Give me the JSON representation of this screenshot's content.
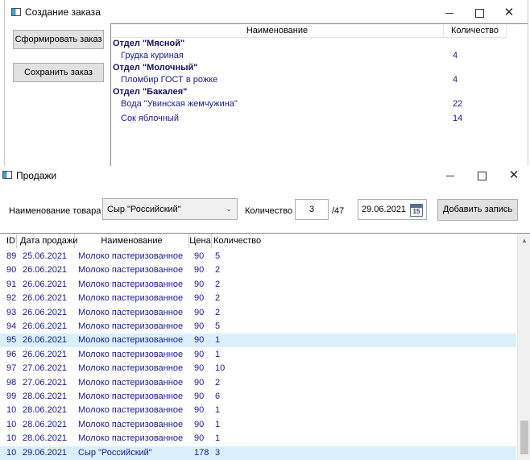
{
  "order_window": {
    "title": "Создание заказа",
    "form_order_label": "Сформировать заказ",
    "save_order_label": "Сохранить заказ",
    "columns": {
      "name": "Наименование",
      "qty": "Количество"
    },
    "groups": [
      {
        "header": "Отдел \"Мясной\"",
        "items": [
          {
            "name": "Грудка куриная",
            "qty": "4"
          }
        ]
      },
      {
        "header": "Отдел \"Молочный\"",
        "items": [
          {
            "name": "Пломбир ГОСТ в рожке",
            "qty": "4"
          }
        ]
      },
      {
        "header": "Отдел \"Бакалея\"",
        "items": [
          {
            "name": "Вода \"Увинская жемчужина\"",
            "qty": "22"
          },
          {
            "name": "Сок яблочный",
            "qty": "14"
          }
        ]
      }
    ]
  },
  "sales_window": {
    "title": "Продажи",
    "product_label": "Наименование товара",
    "product_value": "Сыр \"Российский\"",
    "qty_label": "Количество",
    "qty_value": "3",
    "qty_available": "/47",
    "date_value": "29.06.2021",
    "calendar_day": "15",
    "add_button_label": "Добавить запись",
    "columns": {
      "id": "ID",
      "date": "Дата продажи",
      "name": "Наименование",
      "price": "Цена",
      "qty": "Количество"
    },
    "selected_color": "#d9f0fb",
    "rows": [
      {
        "id": "89",
        "date": "25.06.2021",
        "name": "Молоко пастеризованное",
        "price": "90",
        "qty": "5"
      },
      {
        "id": "90",
        "date": "26.06.2021",
        "name": "Молоко пастеризованное",
        "price": "90",
        "qty": "2"
      },
      {
        "id": "91",
        "date": "26.06.2021",
        "name": "Молоко пастеризованное",
        "price": "90",
        "qty": "2"
      },
      {
        "id": "92",
        "date": "26.06.2021",
        "name": "Молоко пастеризованное",
        "price": "90",
        "qty": "2"
      },
      {
        "id": "93",
        "date": "26.06.2021",
        "name": "Молоко пастеризованное",
        "price": "90",
        "qty": "2"
      },
      {
        "id": "94",
        "date": "26.06.2021",
        "name": "Молоко пастеризованное",
        "price": "90",
        "qty": "5"
      },
      {
        "id": "95",
        "date": "26.06.2021",
        "name": "Молоко пастеризованное",
        "price": "90",
        "qty": "1",
        "selected": true
      },
      {
        "id": "96",
        "date": "26.06.2021",
        "name": "Молоко пастеризованное",
        "price": "90",
        "qty": "1"
      },
      {
        "id": "97",
        "date": "27.06.2021",
        "name": "Молоко пастеризованное",
        "price": "90",
        "qty": "10"
      },
      {
        "id": "98",
        "date": "27.06.2021",
        "name": "Молоко пастеризованное",
        "price": "90",
        "qty": "2"
      },
      {
        "id": "99",
        "date": "28.06.2021",
        "name": "Молоко пастеризованное",
        "price": "90",
        "qty": "6"
      },
      {
        "id": "10",
        "date": "28.06.2021",
        "name": "Молоко пастеризованное",
        "price": "90",
        "qty": "1"
      },
      {
        "id": "10",
        "date": "28.06.2021",
        "name": "Молоко пастеризованное",
        "price": "90",
        "qty": "1"
      },
      {
        "id": "10",
        "date": "28.06.2021",
        "name": "Молоко пастеризованное",
        "price": "90",
        "qty": "1"
      },
      {
        "id": "10",
        "date": "29.06.2021",
        "name": "Сыр \"Российский\"",
        "price": "178",
        "qty": "3",
        "selected": true
      }
    ]
  }
}
